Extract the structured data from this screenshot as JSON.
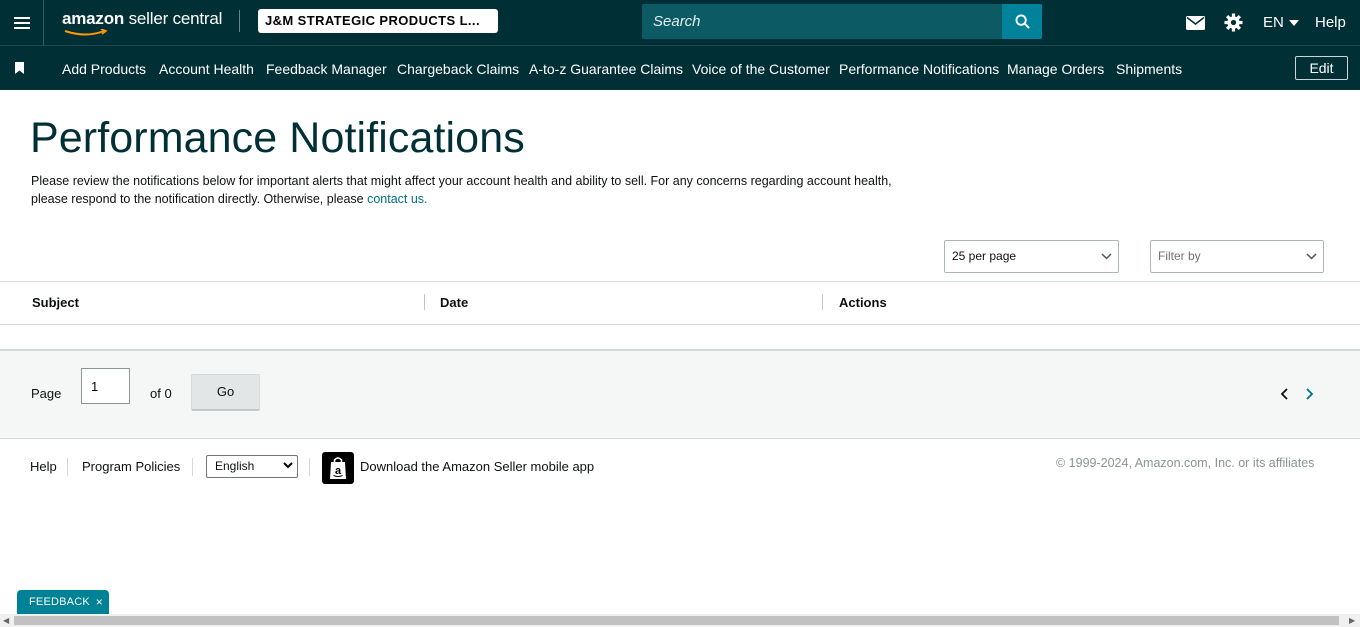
{
  "header": {
    "logo_text_bold": "amazon",
    "logo_text_rest": " seller central",
    "account_name": "J&M STRATEGIC PRODUCTS L...",
    "search_placeholder": "Search",
    "language": "EN",
    "help_label": "Help",
    "icons": [
      "menu-icon",
      "search-icon",
      "mail-icon",
      "gear-icon",
      "chevron-down-icon"
    ]
  },
  "nav": {
    "items": [
      "Add Products",
      "Account Health",
      "Feedback Manager",
      "Chargeback Claims",
      "A-to-z Guarantee Claims",
      "Voice of the Customer",
      "Performance Notifications",
      "Manage Orders",
      "Shipments"
    ],
    "edit_label": "Edit"
  },
  "main": {
    "title": "Performance Notifications",
    "description": "Please review the notifications below for important alerts that might affect your account health and ability to sell. For any concerns regarding account health, please respond to the notification directly. Otherwise, please",
    "contact_link": "contact us.",
    "per_page": "25 per page",
    "filter_placeholder": "Filter by",
    "columns": [
      "Subject",
      "Date",
      "Actions"
    ]
  },
  "pagination": {
    "page_label": "Page",
    "page_value": "1",
    "of_label": "of 0",
    "go_label": "Go"
  },
  "footer": {
    "help": "Help",
    "program_policies": "Program Policies",
    "language_selected": "English",
    "app_download": "Download the Amazon Seller mobile app",
    "copyright": "© 1999-2024, Amazon.com, Inc. or its affiliates"
  },
  "feedback": {
    "label": "FEEDBACK",
    "close": "×"
  },
  "colors": {
    "header_bg": "#002f36",
    "search_bg": "#0b5a64",
    "accent": "#00829a",
    "link": "#007185"
  }
}
